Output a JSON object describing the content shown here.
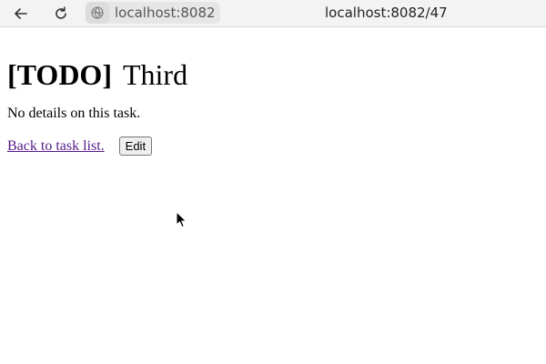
{
  "browser": {
    "address_host": "localhost:8082",
    "page_url": "localhost:8082/47",
    "icons": {
      "back": "arrow-left-icon",
      "reload": "reload-icon",
      "site": "globe-icon"
    }
  },
  "task": {
    "status": "[TODO]",
    "name": "Third",
    "details": "No details on this task."
  },
  "actions": {
    "back_link": "Back to task list.",
    "edit_label": "Edit"
  },
  "colors": {
    "visited_link": "#551a8b",
    "toolbar_bg": "#f3f3f3"
  }
}
